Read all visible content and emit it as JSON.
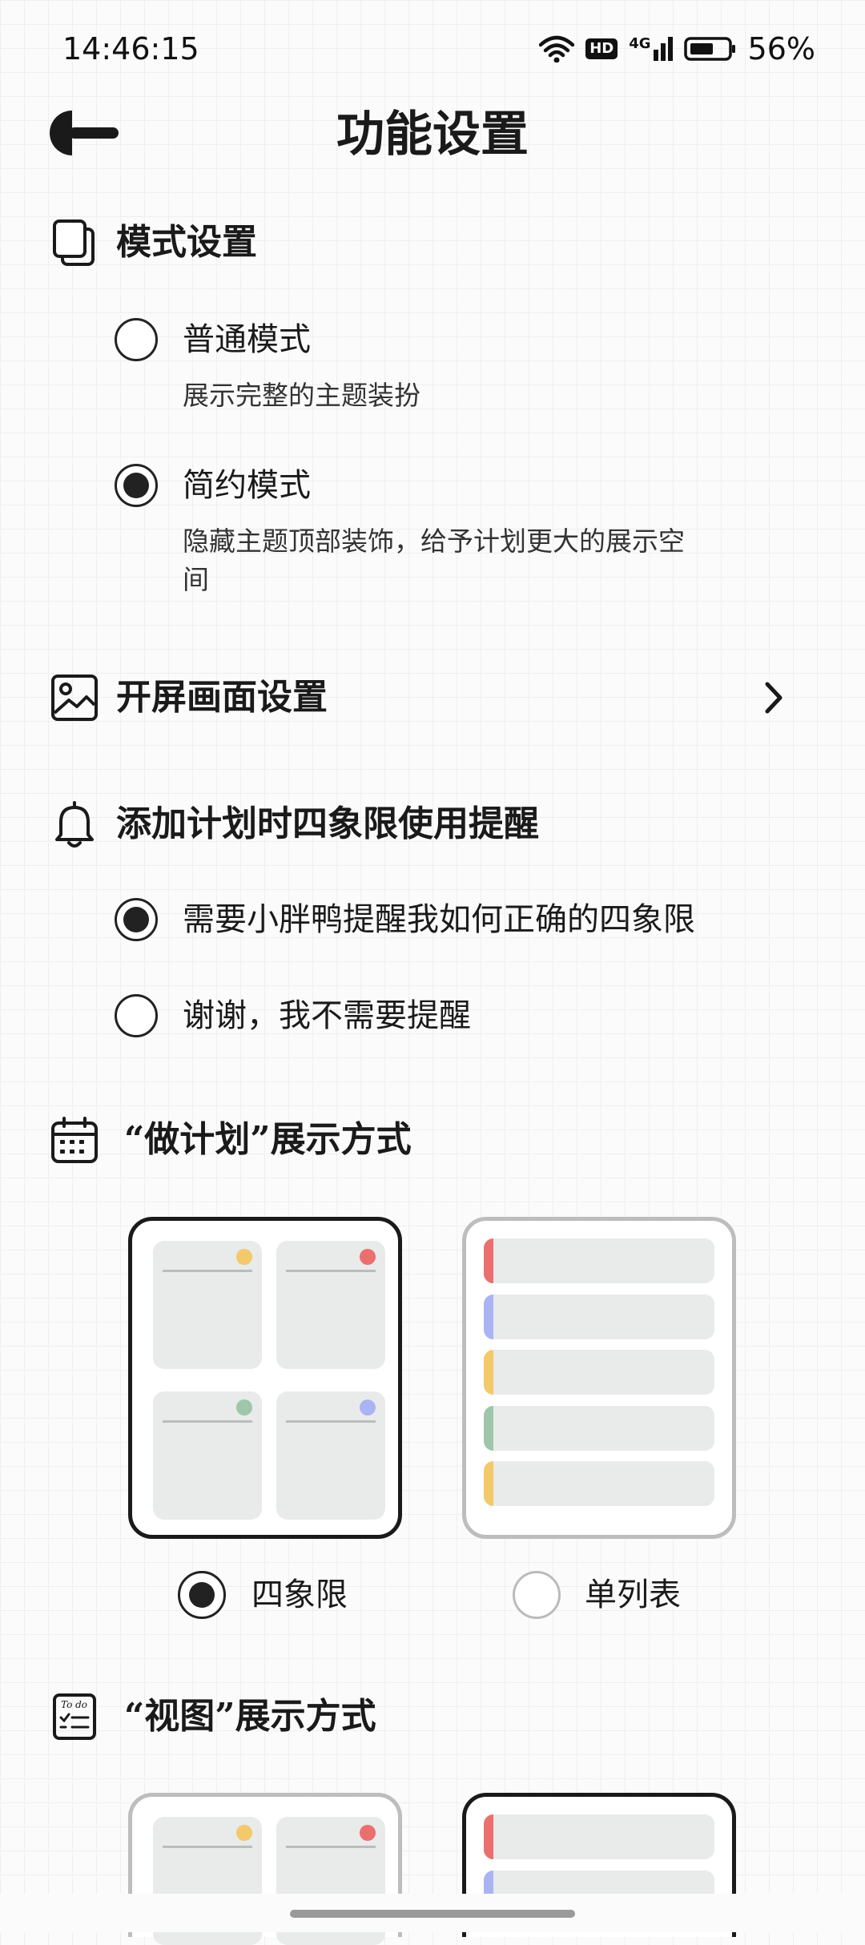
{
  "status_bar": {
    "time": "14:46:15",
    "battery_percent": "56%",
    "hd_badge": "HD",
    "network_badge": "4G",
    "icons": [
      "wifi-icon",
      "hd-icon",
      "signal-icon",
      "battery-icon"
    ]
  },
  "header": {
    "title": "功能设置",
    "back_icon": "back-arrow-icon"
  },
  "mode_section": {
    "title": "模式设置",
    "icon": "pages-icon",
    "options": [
      {
        "label": "普通模式",
        "desc": "展示完整的主题装扮",
        "checked": false
      },
      {
        "label": "简约模式",
        "desc_line1": "隐藏主题顶部装饰，给予计划更大的展示空",
        "desc_line2": "间",
        "checked": true
      }
    ]
  },
  "splash_section": {
    "title": "开屏画面设置",
    "icon": "image-icon",
    "chevron_icon": "chevron-right-icon"
  },
  "reminder_section": {
    "title": "添加计划时四象限使用提醒",
    "icon": "bell-icon",
    "options": [
      {
        "label": "需要小胖鸭提醒我如何正确的四象限",
        "checked": true
      },
      {
        "label": "谢谢，我不需要提醒",
        "checked": false
      }
    ]
  },
  "plan_display_section": {
    "title": "“做计划”展示方式",
    "icon": "calendar-icon",
    "options": [
      {
        "label": "四象限",
        "checked": true
      },
      {
        "label": "单列表",
        "checked": false
      }
    ]
  },
  "view_display_section": {
    "title": "“视图”展示方式",
    "icon": "todo-list-icon",
    "todo_icon_text": "To do"
  },
  "colors": {
    "yellow": "#f3c96a",
    "red": "#ec6f6f",
    "green": "#9ec7a9",
    "blue": "#aab4f2",
    "text": "#1a1a1a"
  }
}
